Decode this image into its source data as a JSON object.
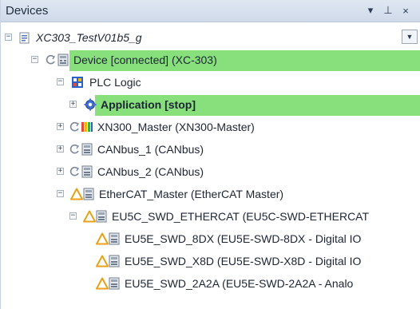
{
  "panel": {
    "title": "Devices",
    "buttons": {
      "menu_glyph": "▾",
      "pin_glyph": "⊥",
      "close_glyph": "×"
    }
  },
  "tree": {
    "root": {
      "label": "XC303_TestV01b5_g",
      "icon": "project-icon"
    },
    "device": {
      "label": "Device [connected] (XC-303)",
      "icon": "device-icon",
      "state": "connected",
      "highlight": "#87e07c"
    },
    "plc_logic": {
      "label": "PLC Logic",
      "icon": "plc-logic-icon"
    },
    "application": {
      "label": "Application [stop]",
      "icon": "gear-icon",
      "state": "stop",
      "highlight": "#87e07c"
    },
    "xn300": {
      "label": "XN300_Master (XN300-Master)",
      "icon": "io-module-icon"
    },
    "canbus1": {
      "label": "CANbus_1 (CANbus)",
      "icon": "module-icon"
    },
    "canbus2": {
      "label": "CANbus_2 (CANbus)",
      "icon": "module-icon"
    },
    "ethercat": {
      "label": "EtherCAT_Master (EtherCAT Master)",
      "icon": "warning-icon"
    },
    "eu5c": {
      "label": "EU5C_SWD_ETHERCAT (EU5C-SWD-ETHERCAT",
      "icon": "warning-icon"
    },
    "eu5e_8dx": {
      "label": "EU5E_SWD_8DX (EU5E-SWD-8DX - Digital IO",
      "icon": "warning-icon"
    },
    "eu5e_x8d": {
      "label": "EU5E_SWD_X8D (EU5E-SWD-X8D - Digital IO",
      "icon": "warning-icon"
    },
    "eu5e_2a2a": {
      "label": "EU5E_SWD_2A2A (EU5E-SWD-2A2A - Analo",
      "icon": "warning-icon"
    }
  },
  "colors": {
    "highlight": "#87e07c",
    "warning": "#e8a21a",
    "accent_blue": "#2b62c9"
  }
}
